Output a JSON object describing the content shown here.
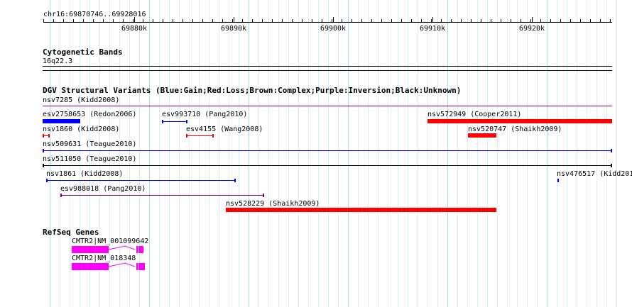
{
  "coords": "chr16:69870746..69928016",
  "ruler_ticks": [
    "69880k",
    "69890k",
    "69900k",
    "69910k",
    "69920k"
  ],
  "cytoband": {
    "title": "Cytogenetic Bands",
    "band": "16q22.3"
  },
  "dgv": {
    "title": "DGV Structural Variants (Blue:Gain;Red:Loss;Brown:Complex;Purple:Inversion;Black:Unknown)",
    "labels": {
      "nsv7285": "nsv7285 (Kidd2008)",
      "esv2758653": "esv2758653 (Redon2006)",
      "esv993710": "esv993710 (Pang2010)",
      "nsv572949": "nsv572949 (Cooper2011)",
      "nsv1860": "nsv1860 (Kidd2008)",
      "esv4155": "esv4155 (Wang2008)",
      "nsv520747": "nsv520747 (Shaikh2009)",
      "nsv509631": "nsv509631 (Teague2010)",
      "nsv511050": "nsv511050 (Teague2010)",
      "nsv1861": "nsv1861 (Kidd2008)",
      "nsv476517": "nsv476517 (Kidd201",
      "esv988018": "esv988018 (Pang2010)",
      "nsv528229": "nsv528229 (Shaikh2009)"
    }
  },
  "refseq": {
    "title": "RefSeq Genes",
    "genes": [
      "CMTR2|NM_001099642",
      "CMTR2|NM_018348"
    ]
  },
  "colors": {
    "gain": "#0000ff",
    "loss": "#ff0000",
    "complex": "#8b4513",
    "inversion": "#800080",
    "unknown": "#000000",
    "gene": "#ff00ff",
    "grid_major": "#b0d8f0",
    "grid_minor": "#d8eefa"
  }
}
